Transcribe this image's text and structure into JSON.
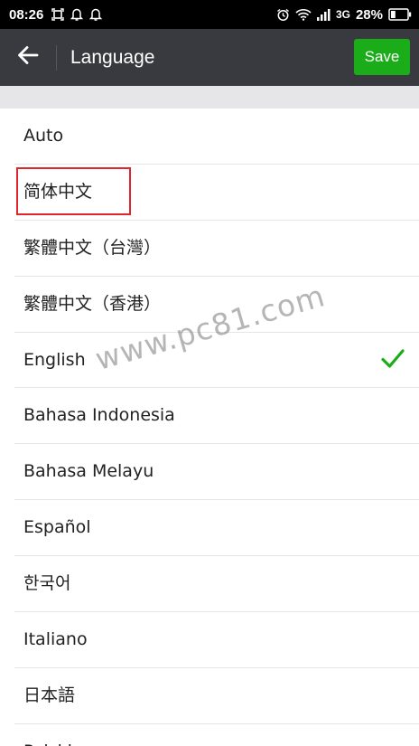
{
  "status_bar": {
    "time": "08:26",
    "network": "3G",
    "battery": "28%",
    "left_icons": [
      "screenshot-icon",
      "notification-icon",
      "notification-icon"
    ],
    "right_icons": [
      "alarm-icon",
      "wifi-icon",
      "signal-icon",
      "battery-icon"
    ]
  },
  "toolbar": {
    "title": "Language",
    "save_label": "Save",
    "back_icon": "back-arrow-icon"
  },
  "languages": [
    {
      "label": "Auto",
      "selected": false
    },
    {
      "label": "简体中文",
      "selected": false,
      "highlighted": true
    },
    {
      "label": "繁體中文（台灣）",
      "selected": false
    },
    {
      "label": "繁體中文（香港）",
      "selected": false
    },
    {
      "label": "English",
      "selected": true
    },
    {
      "label": "Bahasa Indonesia",
      "selected": false
    },
    {
      "label": "Bahasa Melayu",
      "selected": false
    },
    {
      "label": "Español",
      "selected": false
    },
    {
      "label": "한국어",
      "selected": false
    },
    {
      "label": "Italiano",
      "selected": false
    },
    {
      "label": "日本語",
      "selected": false
    },
    {
      "label": "Polski",
      "selected": false
    }
  ],
  "watermark": "www.pc81.com",
  "colors": {
    "toolbar_bg": "#393a3f",
    "save_button": "#1aad19",
    "check": "#1aad19",
    "highlight_border": "#e0262d",
    "spacer": "#e6e6e9"
  }
}
